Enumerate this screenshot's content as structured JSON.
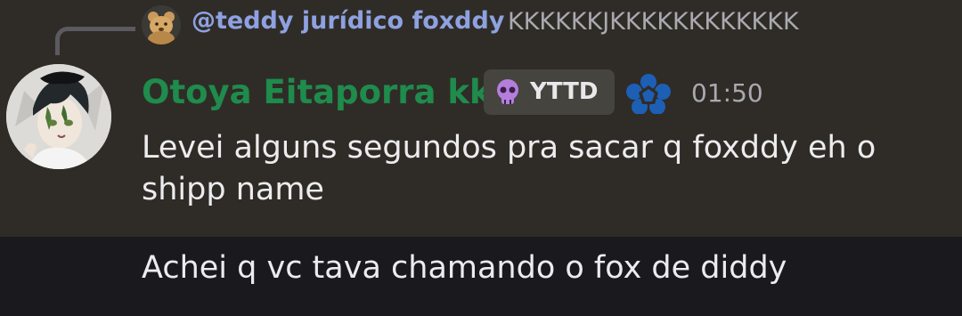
{
  "reply": {
    "mention": "@teddy jurídico foxddy",
    "text": "KKKKKKJKKKKKKKKKKKK",
    "avatar_icon": "teddy-bear-avatar"
  },
  "message": {
    "username": "Otoya Eitaporra kk",
    "username_color": "#1f8b4c",
    "tag": {
      "icon": "skull-icon",
      "label": "YTTD"
    },
    "role_icon": "blue-flower-icon",
    "timestamp": "01:50",
    "content": "Levei alguns segundos pra sacar q foxddy eh o shipp name",
    "avatar_icon": "anime-character-avatar"
  },
  "followup": {
    "content": "Achei q vc tava chamando o fox de diddy"
  }
}
